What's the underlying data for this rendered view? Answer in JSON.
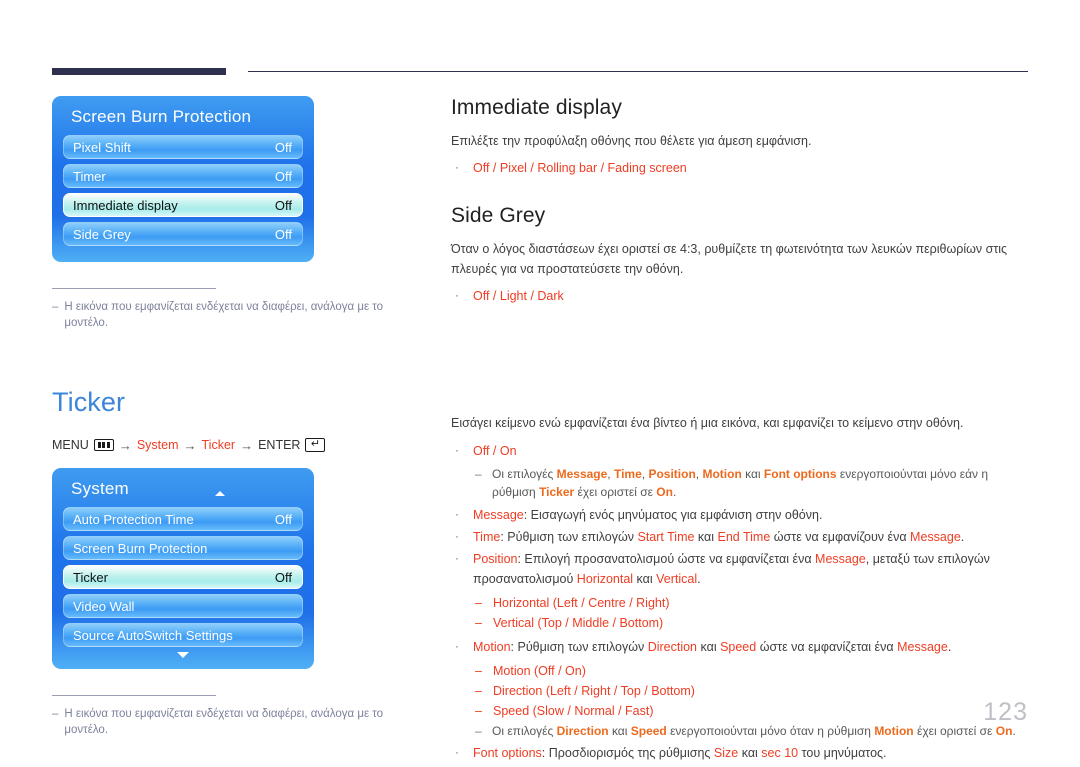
{
  "page": {
    "number": "123"
  },
  "osd_menus": [
    {
      "title": "Screen Burn Protection",
      "rows": [
        {
          "label": "Pixel Shift",
          "value": "Off",
          "selected": false
        },
        {
          "label": "Timer",
          "value": "Off",
          "selected": false
        },
        {
          "label": "Immediate display",
          "value": "Off",
          "selected": true
        },
        {
          "label": "Side Grey",
          "value": "Off",
          "selected": false
        }
      ],
      "has_caret_up": false,
      "has_caret_down": false
    },
    {
      "title": "System",
      "rows": [
        {
          "label": "Auto Protection Time",
          "value": "Off",
          "selected": false
        },
        {
          "label": "Screen Burn Protection",
          "value": "",
          "selected": false
        },
        {
          "label": "Ticker",
          "value": "Off",
          "selected": true
        },
        {
          "label": "Video Wall",
          "value": "",
          "selected": false
        },
        {
          "label": "Source AutoSwitch Settings",
          "value": "",
          "selected": false
        }
      ],
      "has_caret_up": true,
      "has_caret_down": true
    }
  ],
  "footnote": {
    "dash": "–",
    "text": "Η εικόνα που εμφανίζεται ενδέχεται να διαφέρει, ανάλογα με το μοντέλο."
  },
  "sections": {
    "immediate_display": {
      "heading": "Immediate display",
      "body": "Επιλέξτε την προφύλαξη οθόνης που θέλετε για άμεση εμφάνιση.",
      "options": "Off / Pixel / Rolling bar / Fading screen"
    },
    "side_grey": {
      "heading": "Side Grey",
      "body": "Όταν ο λόγος διαστάσεων έχει οριστεί σε 4:3, ρυθμίζετε τη φωτεινότητα των λευκών περιθωρίων στις πλευρές για να προστατεύσετε την οθόνη.",
      "options": "Off / Light / Dark"
    },
    "ticker": {
      "heading": "Ticker",
      "menu_path": {
        "menu_label": "MENU",
        "menu_icon": "menu-icon",
        "arrow1": "→",
        "item1": "System",
        "arrow2": "→",
        "item2": "Ticker",
        "arrow3": "→",
        "enter_label": "ENTER",
        "enter_icon": "enter-icon"
      },
      "body": "Εισάγει κείμενο ενώ εμφανίζεται ένα βίντεο ή μια εικόνα, και εμφανίζει το κείμενο στην οθόνη.",
      "bullets": {
        "on_off": "Off / On",
        "note1": {
          "dash": "–",
          "p1": "Οι επιλογές ",
          "t1": "Message",
          "c1": ", ",
          "t2": "Time",
          "c2": ", ",
          "t3": "Position",
          "c3": ", ",
          "t4": "Motion",
          "p2": " και ",
          "t5": "Font options",
          "p3": " ενεργοποιούνται μόνο εάν η ρύθμιση ",
          "t6": "Ticker",
          "p4": " έχει οριστεί σε ",
          "t7": "On",
          "p5": "."
        },
        "message": {
          "term": "Message",
          "text": ": Εισαγωγή ενός μηνύματος για εμφάνιση στην οθόνη."
        },
        "time": {
          "term": "Time",
          "p1": ": Ρύθμιση των επιλογών ",
          "t1": "Start Time",
          "p2": " και ",
          "t2": "End Time",
          "p3": " ώστε να εμφανίζουν ένα ",
          "t3": "Message",
          "p4": "."
        },
        "position": {
          "term": "Position",
          "p1": ": Επιλογή προσανατολισμού ώστε να εμφανίζεται ένα ",
          "t1": "Message",
          "p2": ", μεταξύ των επιλογών προσανατολισμού ",
          "t2": "Horizontal",
          "p3": " και ",
          "t3": "Vertical",
          "p4": ".",
          "sub": [
            {
              "term": "Horizontal",
              "opts": "(Left / Centre / Right)"
            },
            {
              "term": "Vertical",
              "opts": "(Top / Middle / Bottom)"
            }
          ]
        },
        "motion": {
          "term": "Motion",
          "p1": ": Ρύθμιση των επιλογών ",
          "t1": "Direction",
          "p2": " και ",
          "t2": "Speed",
          "p3": " ώστε να εμφανίζεται ένα ",
          "t3": "Message",
          "p4": ".",
          "sub": [
            {
              "term": "Motion",
              "opts": "(Off / On)"
            },
            {
              "term": "Direction",
              "opts": "(Left / Right / Top / Bottom)"
            },
            {
              "term": "Speed",
              "opts": "(Slow / Normal / Fast)"
            }
          ]
        },
        "note2": {
          "dash": "–",
          "p1": "Οι επιλογές ",
          "t1": "Direction",
          "p2": " και ",
          "t2": "Speed",
          "p3": " ενεργοποιούνται μόνο όταν η ρύθμιση ",
          "t3": "Motion",
          "p4": " έχει οριστεί σε ",
          "t4": "On",
          "p5": "."
        },
        "font_options": {
          "term": "Font options",
          "p1": ": Προσδιορισμός της ρύθμισης ",
          "t1": "Size",
          "p2": " και ",
          "t2": "sec 10",
          "p3": " του μηνύματος."
        }
      }
    }
  },
  "bullet_glyph": "·",
  "sub_dash_glyph": "–",
  "colors": {
    "accent_blue": "#3b86d8",
    "accent_red": "#ee3d23",
    "accent_orange": "#ec6a1e",
    "header_navy": "#2e3050",
    "osd_blue": "#1f72ea",
    "page_number_gray": "#bfc0c6"
  }
}
